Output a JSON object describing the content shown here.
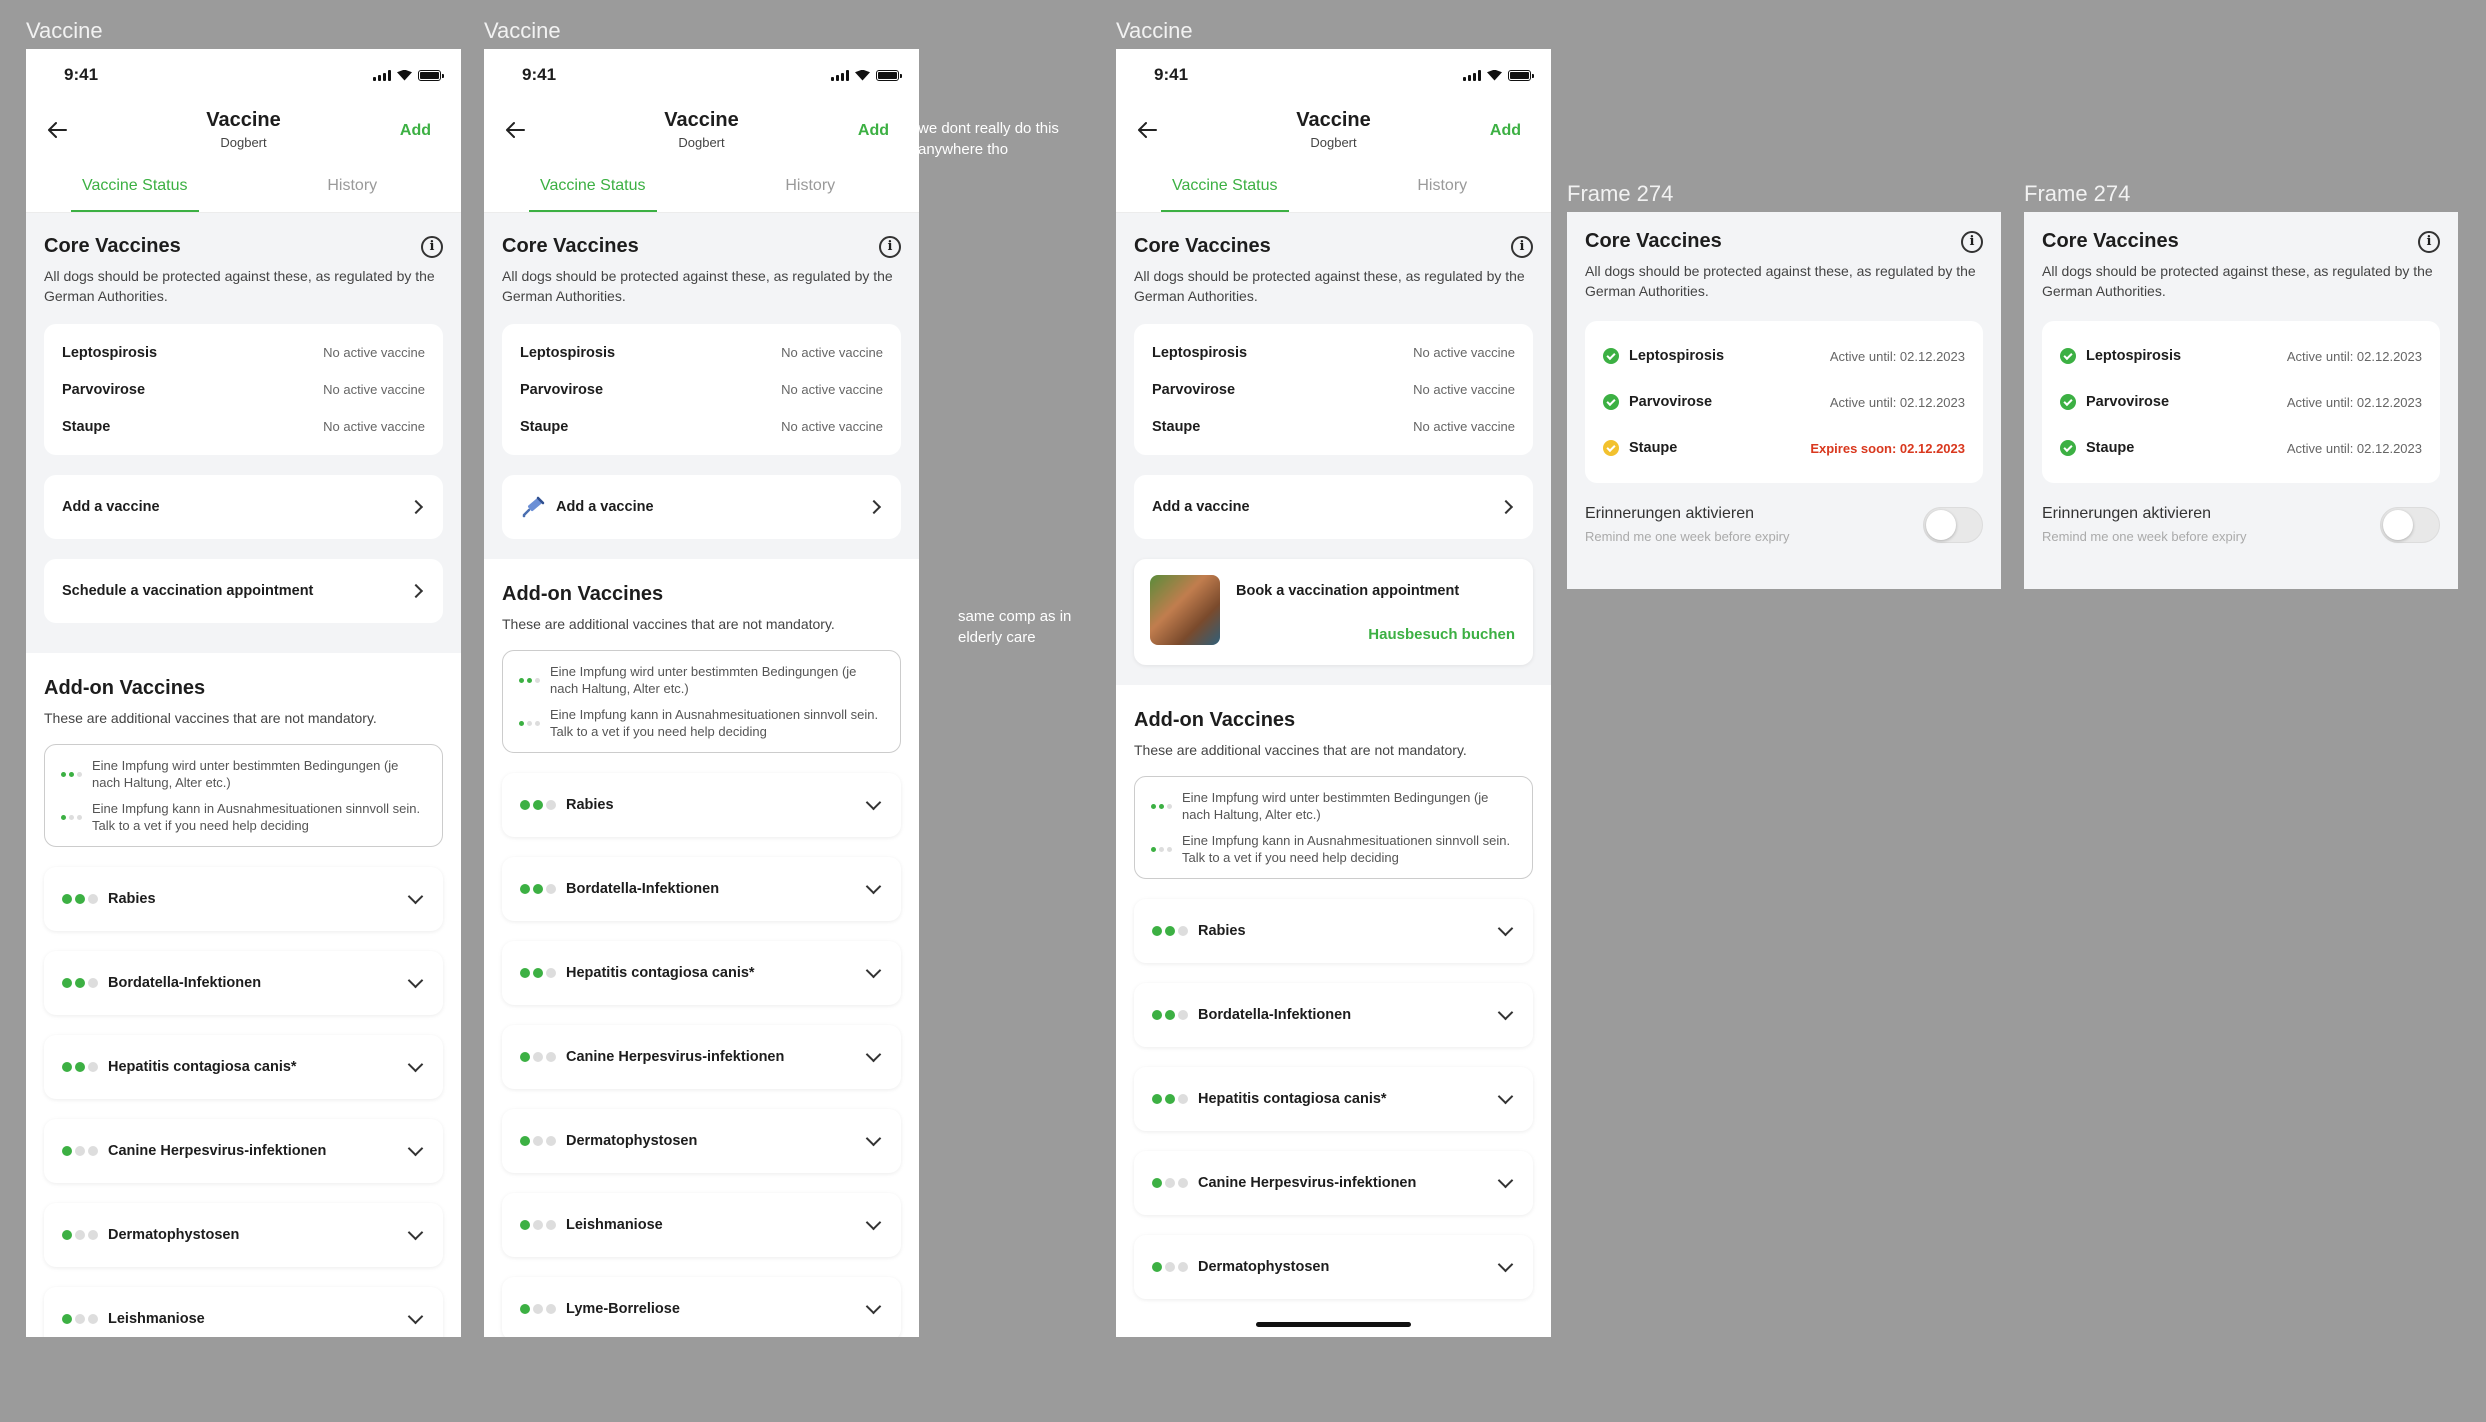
{
  "frames": {
    "phone_label": "Vaccine",
    "panel_label": "Frame 274"
  },
  "notes": {
    "note1": "we dont really do this anywhere tho",
    "note2": "same comp as in elderly care"
  },
  "status": {
    "time": "9:41"
  },
  "nav": {
    "title": "Vaccine",
    "subtitle": "Dogbert",
    "add": "Add"
  },
  "tabs": {
    "status": "Vaccine Status",
    "history": "History"
  },
  "core": {
    "title": "Core Vaccines",
    "desc": "All dogs should be protected against these, as regulated by the German Authorities.",
    "vaccines": [
      {
        "name": "Leptospirosis",
        "status": "No active vaccine"
      },
      {
        "name": "Parvovirose",
        "status": "No active vaccine"
      },
      {
        "name": "Staupe",
        "status": "No active vaccine"
      }
    ]
  },
  "actions": {
    "add_vaccine": "Add a vaccine",
    "schedule": "Schedule a vaccination appointment",
    "book_title": "Book a vaccination appointment",
    "book_link": "Hausbesuch buchen"
  },
  "addon": {
    "title": "Add-on Vaccines",
    "desc": "These are additional vaccines that are not mandatory.",
    "legend1": "Eine Impfung wird unter bestimmten Bedingungen (je nach Haltung, Alter etc.)",
    "legend2": "Eine Impfung kann in Ausnahmesituationen sinnvoll sein. Talk to a vet if you need help deciding",
    "items": [
      {
        "name": "Rabies",
        "level": 2
      },
      {
        "name": "Bordatella-Infektionen",
        "level": 2
      },
      {
        "name": "Hepatitis contagiosa canis*",
        "level": 2
      },
      {
        "name": "Canine Herpesvirus-infektionen",
        "level": 1
      },
      {
        "name": "Dermatophystosen",
        "level": 1
      },
      {
        "name": "Leishmaniose",
        "level": 1
      },
      {
        "name": "Lyme-Borreliose",
        "level": 1
      }
    ]
  },
  "panel1": {
    "vaccines": [
      {
        "name": "Leptospirosis",
        "status": "Active until: 02.12.2023",
        "state": "ok"
      },
      {
        "name": "Parvovirose",
        "status": "Active until: 02.12.2023",
        "state": "ok"
      },
      {
        "name": "Staupe",
        "status": "Expires soon: 02.12.2023",
        "state": "warn"
      }
    ]
  },
  "panel2": {
    "vaccines": [
      {
        "name": "Leptospirosis",
        "status": "Active until: 02.12.2023",
        "state": "ok"
      },
      {
        "name": "Parvovirose",
        "status": "Active until: 02.12.2023",
        "state": "ok"
      },
      {
        "name": "Staupe",
        "status": "Active until: 02.12.2023",
        "state": "ok"
      }
    ]
  },
  "reminder": {
    "title": "Erinnerungen aktivieren",
    "sub": "Remind me one week before expiry",
    "enabled": false
  },
  "colors": {
    "accent": "#3cb043",
    "warning": "#f2c12e",
    "danger": "#d9381e"
  }
}
